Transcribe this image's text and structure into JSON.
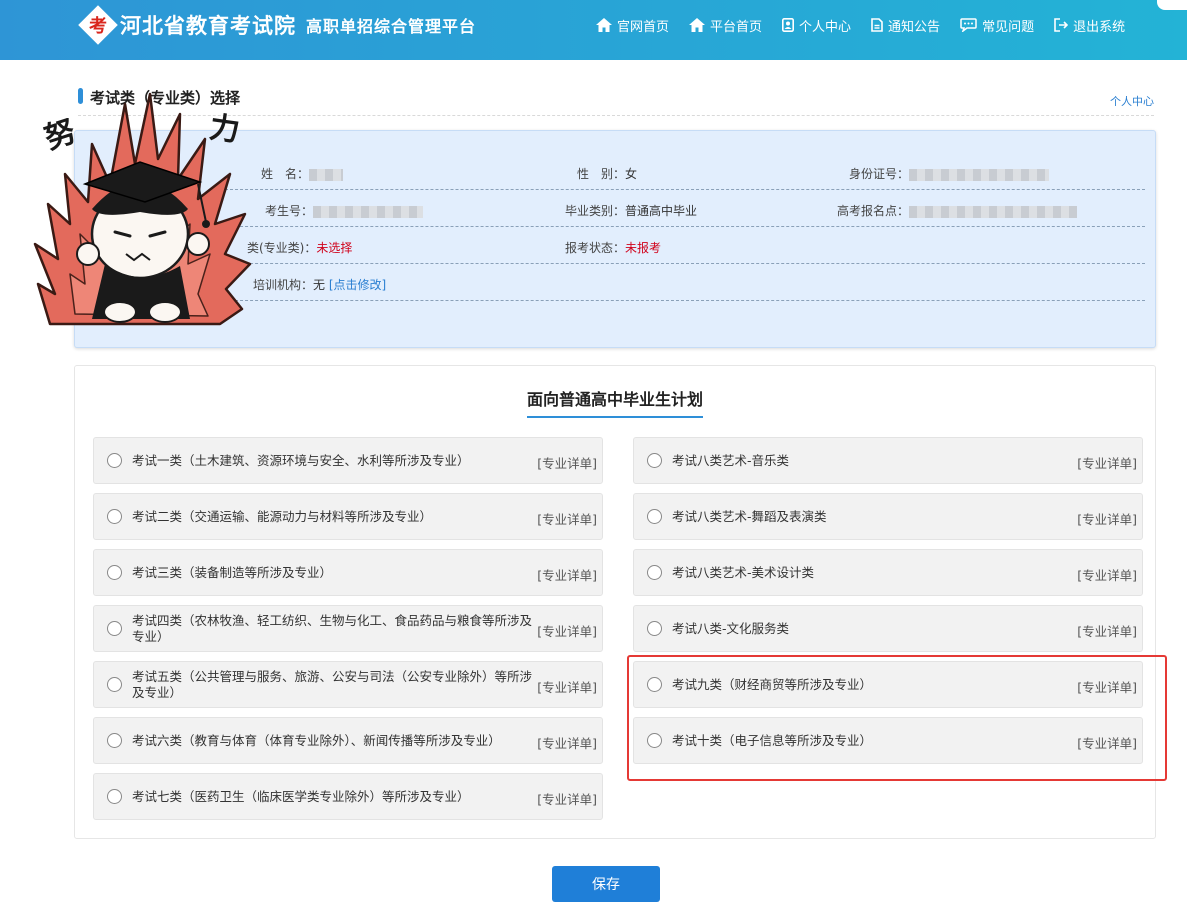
{
  "header": {
    "logo_mark": "考",
    "title": "河北省教育考试院",
    "subtitle": "高职单招综合管理平台",
    "nav": [
      {
        "label": "官网首页",
        "icon": "home-icon"
      },
      {
        "label": "平台首页",
        "icon": "home-icon"
      },
      {
        "label": "个人中心",
        "icon": "user-card-icon"
      },
      {
        "label": "通知公告",
        "icon": "document-icon"
      },
      {
        "label": "常见问题",
        "icon": "chat-icon"
      },
      {
        "label": "退出系统",
        "icon": "logout-icon"
      }
    ]
  },
  "section": {
    "title": "考试类（专业类）选择",
    "link": "个人中心"
  },
  "sticker": {
    "text_left": "努",
    "text_right": "力"
  },
  "info": {
    "name_label": "姓　名：",
    "gender_label": "性　别：",
    "gender_value": "女",
    "id_label": "身份证号：",
    "exam_no_label": "考生号：",
    "grad_type_label": "毕业类别：",
    "grad_type_value": "普通高中毕业",
    "site_label": "高考报名点：",
    "category_label": "类(专业类)：",
    "category_value": "未选择",
    "status_label": "报考状态：",
    "status_value": "未报考",
    "training_label": "培训机构：",
    "training_value": "无",
    "training_link": "[点击修改]"
  },
  "plan": {
    "title": "面向普通高中毕业生计划",
    "detail_label": "[专业详单]",
    "left": [
      "考试一类（土木建筑、资源环境与安全、水利等所涉及专业）",
      "考试二类（交通运输、能源动力与材料等所涉及专业）",
      "考试三类（装备制造等所涉及专业）",
      "考试四类（农林牧渔、轻工纺织、生物与化工、食品药品与粮食等所涉及专业）",
      "考试五类（公共管理与服务、旅游、公安与司法（公安专业除外）等所涉及专业）",
      "考试六类（教育与体育（体育专业除外）、新闻传播等所涉及专业）",
      "考试七类（医药卫生（临床医学类专业除外）等所涉及专业）"
    ],
    "right": [
      "考试八类艺术-音乐类",
      "考试八类艺术-舞蹈及表演类",
      "考试八类艺术-美术设计类",
      "考试八类-文化服务类",
      "考试九类（财经商贸等所涉及专业）",
      "考试十类（电子信息等所涉及专业）"
    ]
  },
  "save_label": "保存",
  "colors": {
    "header_start": "#2e95d6",
    "header_end": "#23b3d6",
    "accent": "#1f7fd8",
    "alert": "#d0021b",
    "highlight": "#e53935"
  }
}
